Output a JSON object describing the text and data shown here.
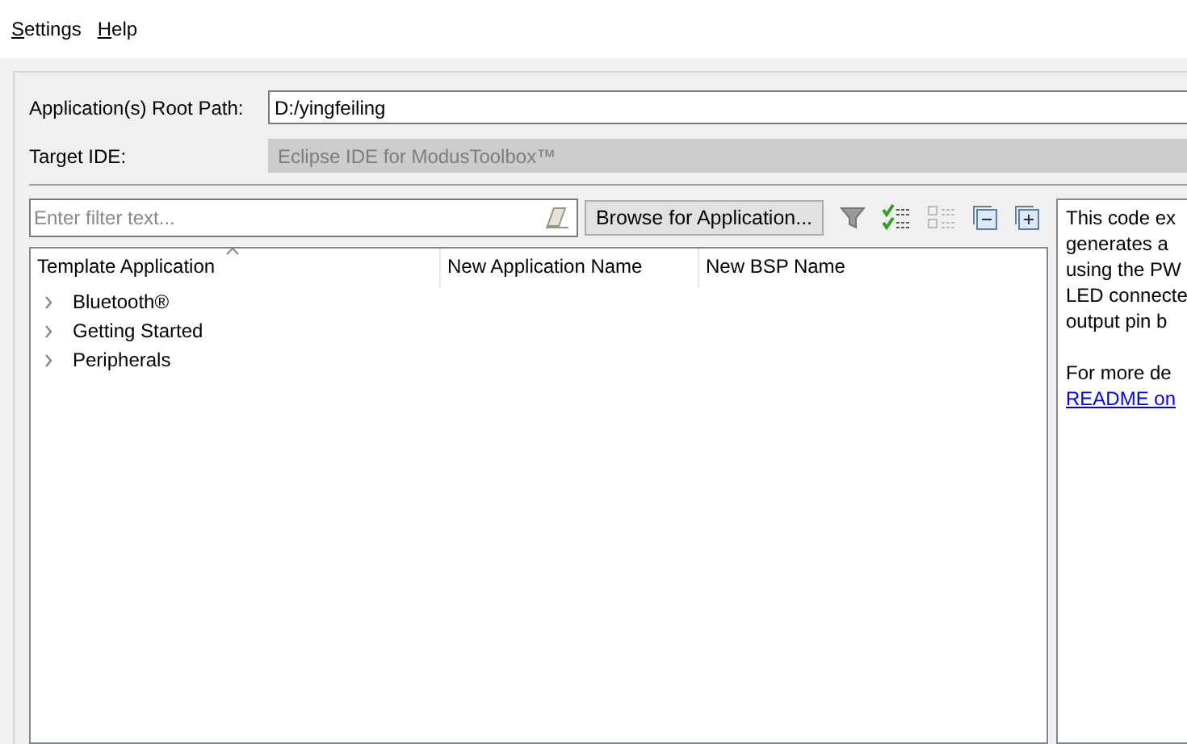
{
  "menu": [
    {
      "label": "Settings"
    },
    {
      "label": "Help"
    }
  ],
  "root_path": {
    "label": "Application(s) Root Path:",
    "value": "D:/yingfeiling"
  },
  "target_ide": {
    "label": "Target IDE:",
    "value": "Eclipse IDE for ModusToolbox™",
    "disabled": true
  },
  "filter": {
    "placeholder": "Enter filter text..."
  },
  "browse_button": "Browse for Application...",
  "table": {
    "columns": [
      "Template Application",
      "New Application Name",
      "New BSP Name"
    ],
    "rows": [
      {
        "label": "Bluetooth®",
        "expanded": false
      },
      {
        "label": "Getting Started",
        "expanded": false
      },
      {
        "label": "Peripherals",
        "expanded": false
      }
    ]
  },
  "description": {
    "lines": [
      "This code ex",
      "generates a",
      "using the PW",
      "LED connecte",
      "output pin b"
    ],
    "more_lines": [
      "For more de"
    ],
    "link": "README on"
  }
}
